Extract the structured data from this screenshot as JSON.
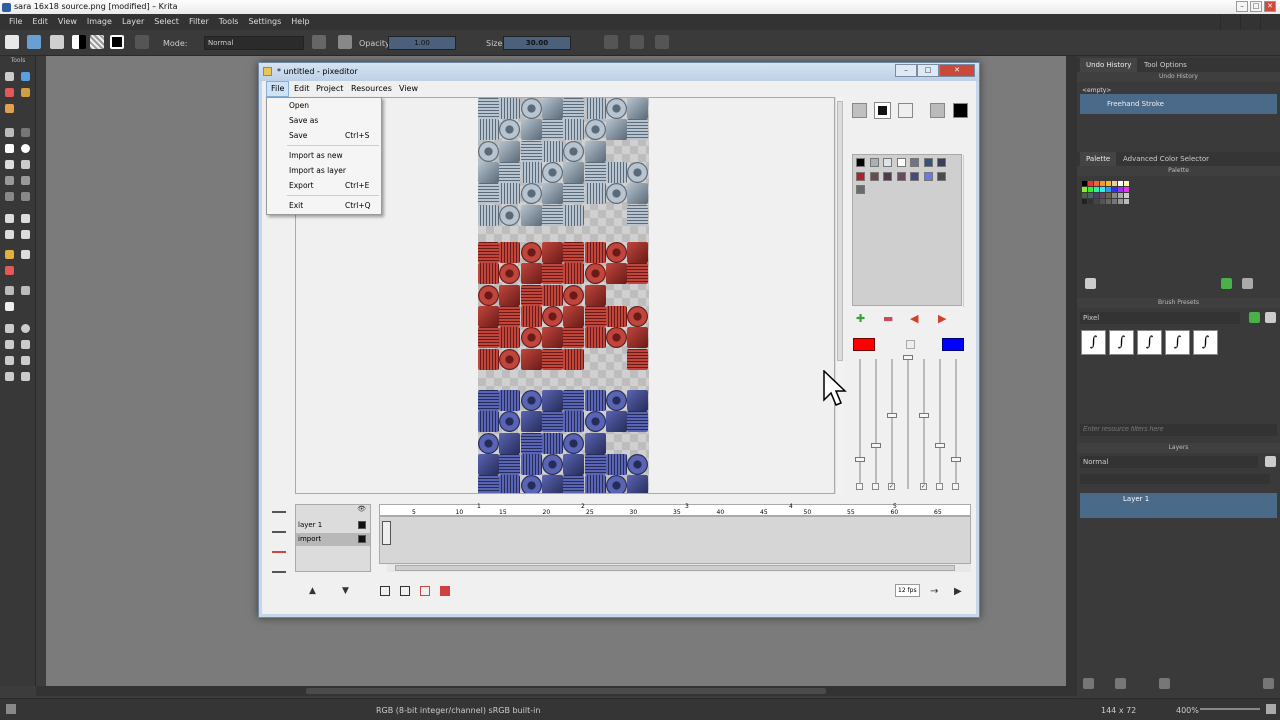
{
  "krita": {
    "window_title": "sara 16x18 source.png [modified] – Krita",
    "menu": [
      "File",
      "Edit",
      "View",
      "Image",
      "Layer",
      "Select",
      "Filter",
      "Tools",
      "Settings",
      "Help"
    ],
    "toolbar": {
      "mode_label": "Mode:",
      "mode_value": "Normal",
      "opacity_label": "Opacity:",
      "opacity_value": "1.00",
      "size_label": "Size:",
      "size_value": "30.00"
    },
    "toolbox_title": "Tools",
    "dockers": {
      "top_tabs": [
        "Undo History",
        "Tool Options"
      ],
      "undo_header": "Undo History",
      "undo_empty": "<empty>",
      "undo_entry": "Freehand Stroke",
      "color_tabs": [
        "Palette",
        "Advanced Color Selector"
      ],
      "palette_header": "Palette",
      "brush_presets_header": "Brush Presets",
      "brush_tag": "Pixel",
      "resource_filter_placeholder": "Enter resource filters here",
      "layers_header": "Layers",
      "layers_blend_mode": "Normal",
      "layer_name": "Layer 1"
    },
    "status": {
      "color_space": "RGB (8-bit integer/channel)  sRGB built-in",
      "dimensions": "144 x 72",
      "zoom": "400%"
    }
  },
  "pixeditor": {
    "window_title": "* untitled - pixeditor",
    "menu": [
      "File",
      "Edit",
      "Project",
      "Resources",
      "View"
    ],
    "file_menu": [
      {
        "label": "Open",
        "shortcut": ""
      },
      {
        "label": "Save as",
        "shortcut": ""
      },
      {
        "label": "Save",
        "shortcut": "Ctrl+S"
      },
      {
        "label": "Import as new",
        "shortcut": ""
      },
      {
        "label": "Import as layer",
        "shortcut": ""
      },
      {
        "label": "Export",
        "shortcut": "Ctrl+E"
      },
      {
        "label": "Exit",
        "shortcut": "Ctrl+Q"
      }
    ],
    "layers": [
      "layer 1",
      "import"
    ],
    "ruler_labels": [
      "5",
      "10",
      "15",
      "20",
      "25",
      "30",
      "35",
      "40",
      "45",
      "50",
      "55",
      "60",
      "65"
    ],
    "ruler_top_numbers": [
      "1",
      "2",
      "3",
      "4",
      "5"
    ],
    "fps": "12 fps",
    "colors": {
      "primary": "#ff0000",
      "secondary": "#0000ff",
      "palette": [
        "#000000",
        "#a9b0b8",
        "#e0e4e8",
        "#ffffff",
        "#6d7682",
        "#335577",
        "#3a3f55",
        "#b02030",
        "#6a4a4a",
        "#4a3a4a",
        "#6a4a60",
        "#4a4a7a",
        "#6a7ae0",
        "#4a4a4a",
        "#6a6a6a"
      ]
    }
  }
}
